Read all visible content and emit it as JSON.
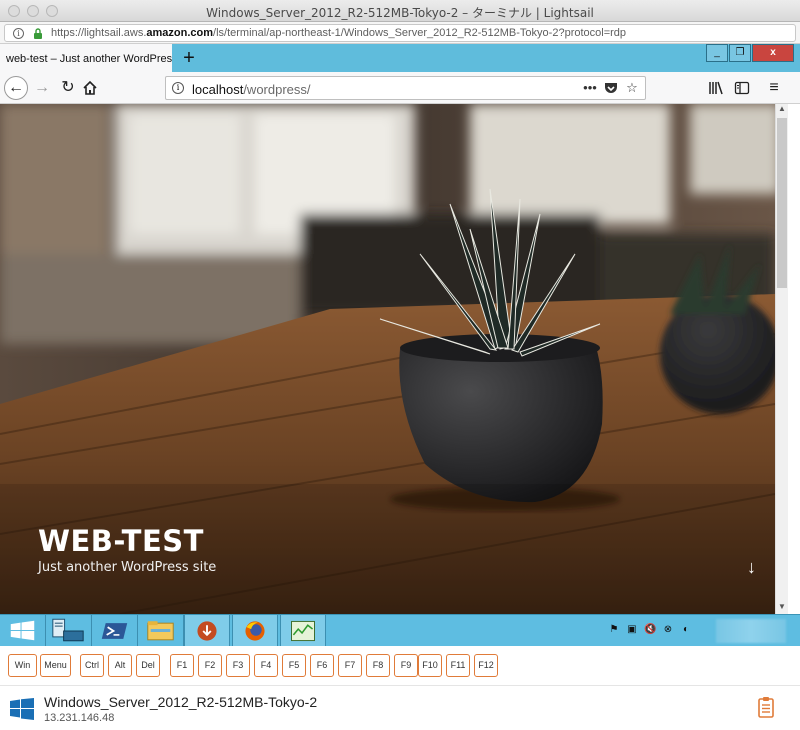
{
  "mac_window": {
    "title": "Windows_Server_2012_R2-512MB-Tokyo-2 – ターミナル | Lightsail",
    "url_prefix": "https://lightsail.aws.",
    "url_domain": "amazon.com",
    "url_suffix": "/ls/terminal/ap-northeast-1/Windows_Server_2012_R2-512MB-Tokyo-2?protocol=rdp"
  },
  "firefox": {
    "tab_title": "web-test – Just another WordPress site",
    "tab_close": "×",
    "new_tab": "+",
    "window_controls": {
      "minimize": "_",
      "restore": "❐",
      "close": "x"
    },
    "url_host": "localhost",
    "url_path": "/wordpress/",
    "toolbar_icons": [
      "back-arrow",
      "forward-arrow",
      "reload",
      "home",
      "page-actions-menu",
      "pocket",
      "bookmark-star",
      "library",
      "sidebar",
      "hamburger-menu"
    ]
  },
  "page": {
    "site_title": "WEB-TEST",
    "tagline": "Just another WordPress site",
    "scroll_down_glyph": "↓"
  },
  "taskbar": {
    "apps": [
      "windows-start",
      "server-manager",
      "powershell",
      "file-explorer",
      "downloader",
      "firefox",
      "task-manager"
    ],
    "active_app": "firefox"
  },
  "keys": [
    "Win",
    "Menu",
    "Ctrl",
    "Alt",
    "Del",
    "F1",
    "F2",
    "F3",
    "F4",
    "F5",
    "F6",
    "F7",
    "F8",
    "F9",
    "F10",
    "F11",
    "F12"
  ],
  "footer": {
    "instance_name": "Windows_Server_2012_R2-512MB-Tokyo-2",
    "ip": "13.231.146.48"
  },
  "colors": {
    "taskbar": "#5ebde1",
    "key_border": "#e07b39",
    "close_red": "#c9453f"
  }
}
